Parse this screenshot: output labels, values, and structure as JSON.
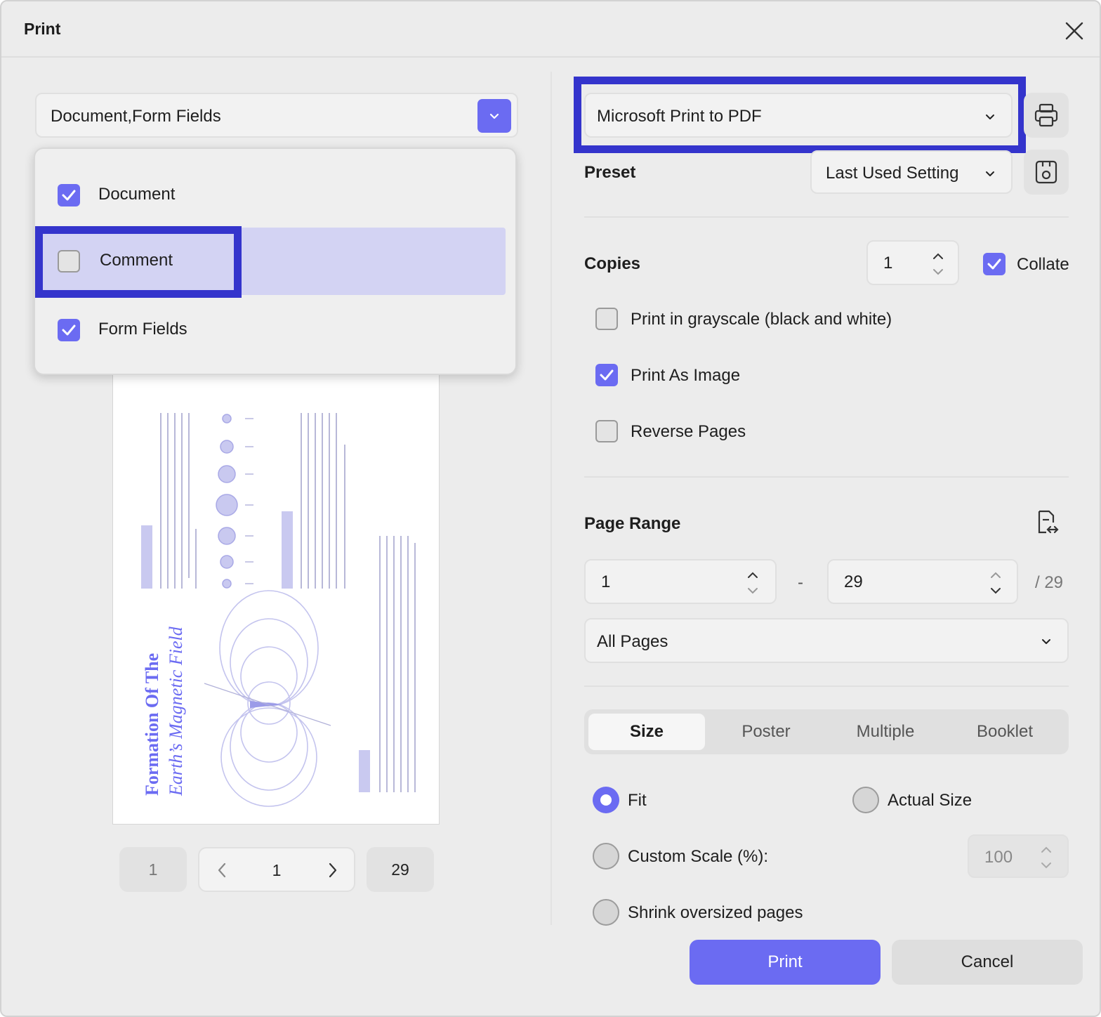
{
  "window": {
    "title": "Print"
  },
  "left": {
    "content_select": {
      "value": "Document,Form Fields"
    },
    "menu": {
      "items": [
        {
          "label": "Document",
          "checked": true
        },
        {
          "label": "Comment",
          "checked": false
        },
        {
          "label": "Form Fields",
          "checked": true
        }
      ]
    },
    "preview": {
      "title_line1": "Formation Of The",
      "title_line2": "Earth’s Magnetic Field"
    },
    "pager": {
      "first": "1",
      "current": "1",
      "last": "29"
    }
  },
  "right": {
    "printer": {
      "value": "Microsoft Print to PDF"
    },
    "preset": {
      "label": "Preset",
      "value": "Last Used Setting"
    },
    "copies": {
      "label": "Copies",
      "value": "1",
      "collate_label": "Collate",
      "collate_checked": true
    },
    "options": [
      {
        "label": "Print in grayscale (black and white)",
        "checked": false
      },
      {
        "label": "Print As Image",
        "checked": true
      },
      {
        "label": "Reverse Pages",
        "checked": false
      }
    ],
    "page_range": {
      "label": "Page Range",
      "from": "1",
      "separator": "-",
      "to": "29",
      "total": "/ 29",
      "mode": "All Pages"
    },
    "tabs": [
      {
        "label": "Size",
        "active": true
      },
      {
        "label": "Poster",
        "active": false
      },
      {
        "label": "Multiple",
        "active": false
      },
      {
        "label": "Booklet",
        "active": false
      }
    ],
    "size": {
      "fit_label": "Fit",
      "actual_label": "Actual Size",
      "custom_label": "Custom Scale (%):",
      "custom_value": "100",
      "shrink_label": "Shrink oversized pages",
      "selected": "Fit"
    }
  },
  "buttons": {
    "print": "Print",
    "cancel": "Cancel"
  },
  "colors": {
    "accent": "#6b6bf2",
    "highlight": "#3434cc",
    "menu_hover": "#d3d3f3"
  }
}
